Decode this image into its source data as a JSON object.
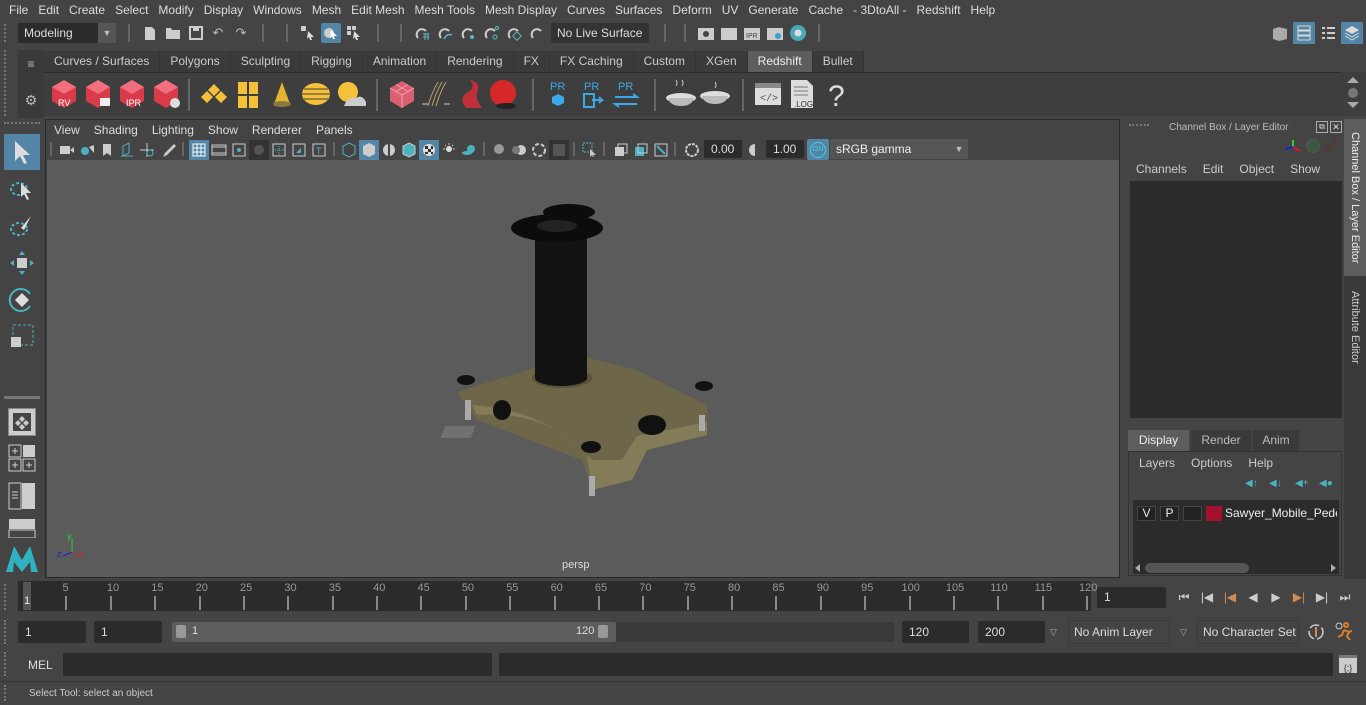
{
  "menubar": [
    "File",
    "Edit",
    "Create",
    "Select",
    "Modify",
    "Display",
    "Windows",
    "Mesh",
    "Edit Mesh",
    "Mesh Tools",
    "Mesh Display",
    "Curves",
    "Surfaces",
    "Deform",
    "UV",
    "Generate",
    "Cache",
    "- 3DtoAll -",
    "Redshift",
    "Help"
  ],
  "statusline": {
    "workspace_menu": "Modeling",
    "live_surface": "No Live Surface"
  },
  "shelf": {
    "tabs": [
      "Curves / Surfaces",
      "Polygons",
      "Sculpting",
      "Rigging",
      "Animation",
      "Rendering",
      "FX",
      "FX Caching",
      "Custom",
      "XGen",
      "Redshift",
      "Bullet"
    ],
    "active_tab": "Redshift",
    "icons": [
      {
        "name": "redshift-render-view-icon",
        "label": "RV"
      },
      {
        "name": "redshift-batch-render-icon",
        "label": ""
      },
      {
        "name": "redshift-ipr-icon",
        "label": "IPR"
      },
      {
        "name": "redshift-render-settings-icon",
        "label": ""
      },
      {
        "name": "rs-area-light-icon",
        "label": ""
      },
      {
        "name": "rs-portal-light-icon",
        "label": ""
      },
      {
        "name": "rs-spot-light-icon",
        "label": ""
      },
      {
        "name": "rs-dome-light-icon",
        "label": ""
      },
      {
        "name": "rs-sun-sky-icon",
        "label": ""
      },
      {
        "name": "rs-proxy-icon",
        "label": ""
      },
      {
        "name": "rs-hair-icon",
        "label": ""
      },
      {
        "name": "rs-volume-icon",
        "label": ""
      },
      {
        "name": "rs-sphere-icon",
        "label": ""
      },
      {
        "name": "pr-mesh-icon",
        "label": "PR"
      },
      {
        "name": "pr-export-icon",
        "label": "PR"
      },
      {
        "name": "pr-convert-icon",
        "label": "PR"
      },
      {
        "name": "rs-baking-icon",
        "label": ""
      },
      {
        "name": "rs-baking-single-icon",
        "label": ""
      },
      {
        "name": "rs-shader-editor-icon",
        "label": ""
      },
      {
        "name": "rs-log-icon",
        "label": "LOG"
      },
      {
        "name": "rs-help-icon",
        "label": "?"
      }
    ]
  },
  "viewport": {
    "menus": [
      "View",
      "Shading",
      "Lighting",
      "Show",
      "Renderer",
      "Panels"
    ],
    "exposure": "0.00",
    "gamma": "1.00",
    "color_management": "ON",
    "view_transform": "sRGB gamma",
    "camera_label": "persp",
    "axis": {
      "x": "x",
      "y": "y",
      "z": "z"
    }
  },
  "channel_box": {
    "title": "Channel Box / Layer Editor",
    "menus": [
      "Channels",
      "Edit",
      "Object",
      "Show"
    ]
  },
  "layer_editor": {
    "tabs": [
      "Display",
      "Render",
      "Anim"
    ],
    "active_tab": "Display",
    "menus": [
      "Layers",
      "Options",
      "Help"
    ],
    "layers": [
      {
        "visible": "V",
        "playback": "P",
        "type": "",
        "color": "#a3112e",
        "name": "Sawyer_Mobile_Pedestal"
      }
    ]
  },
  "side_tabs": [
    "Channel Box / Layer Editor",
    "Attribute Editor"
  ],
  "timeline": {
    "ticks": [
      5,
      10,
      15,
      20,
      25,
      30,
      35,
      40,
      45,
      50,
      55,
      60,
      65,
      70,
      75,
      80,
      85,
      90,
      95,
      100,
      105,
      110,
      115,
      120
    ],
    "current_frame_marker": "1",
    "current_frame": "1"
  },
  "range": {
    "start": "1",
    "playback_start": "1",
    "slider_start": "1",
    "slider_end": "120",
    "playback_end": "120",
    "end": "200",
    "anim_layer": "No Anim Layer",
    "character_set": "No Character Set"
  },
  "command_line": {
    "language": "MEL",
    "input": "",
    "output": ""
  },
  "help_line": "Select Tool: select an object"
}
